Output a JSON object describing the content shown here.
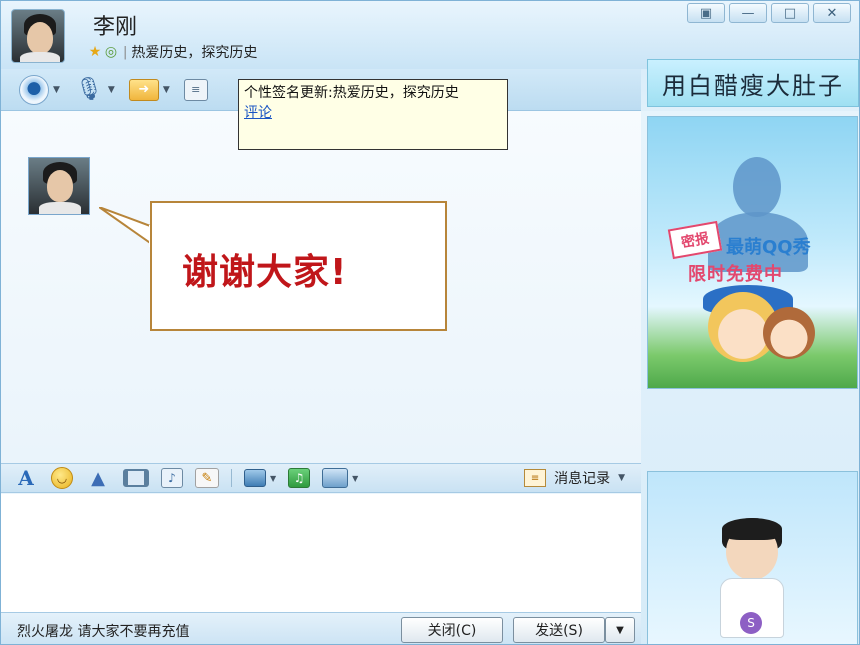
{
  "window": {
    "contact_name": "李刚",
    "signature": "热爱历史，探究历史",
    "controls": [
      "▣",
      "—",
      "□",
      "✕"
    ]
  },
  "toolbar": {
    "items": [
      {
        "icon": "camera-icon"
      },
      {
        "icon": "microphone-icon"
      },
      {
        "icon": "file-transfer-icon"
      },
      {
        "icon": "chat-icon"
      }
    ]
  },
  "banner": {
    "text": "用白醋瘦大肚子"
  },
  "tooltip": {
    "text": "个性签名更新:热爱历史，探究历史",
    "link": "评论"
  },
  "chat": {
    "message": "谢谢大家!"
  },
  "format_bar": {
    "font_glyph": "A",
    "history_label": "消息记录"
  },
  "bottom": {
    "ad_text": "烈火屠龙 请大家不要再充值",
    "close_label": "关闭(C)",
    "send_label": "发送(S)"
  },
  "ad_panel": {
    "tag": "密报",
    "line1": "最萌QQ秀",
    "line2": "限时免费中"
  },
  "colors": {
    "accent": "#2a69b8",
    "message_red": "#c0161a",
    "bubble_border": "#b7853a",
    "tooltip_bg": "#ffffe6"
  }
}
